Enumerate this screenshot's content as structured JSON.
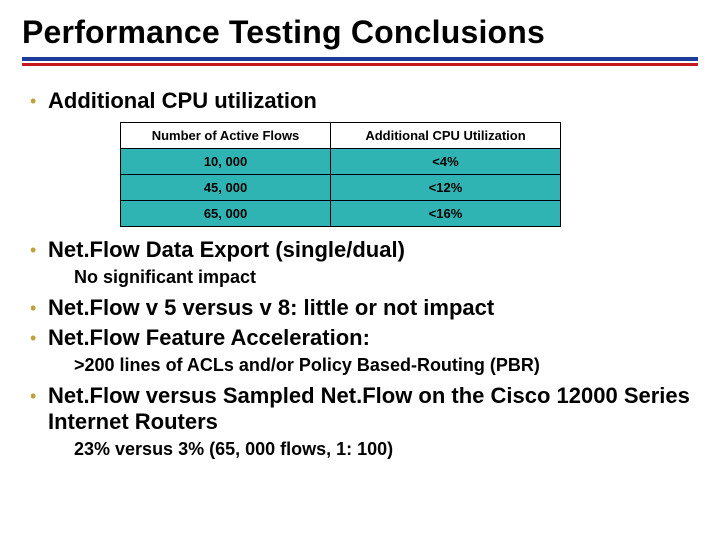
{
  "title": "Performance Testing Conclusions",
  "bullets": {
    "b0": "Additional CPU utilization",
    "b1": "Net.Flow Data Export (single/dual)",
    "b1_sub": "No significant impact",
    "b2": "Net.Flow v 5 versus v 8: little or not impact",
    "b3": "Net.Flow Feature Acceleration:",
    "b3_sub": ">200 lines of ACLs and/or Policy Based-Routing (PBR)",
    "b4": "Net.Flow versus Sampled Net.Flow on the Cisco 12000 Series Internet Routers",
    "b4_sub": "23% versus 3%  (65, 000 flows, 1: 100)"
  },
  "table": {
    "headers": {
      "h0": "Number of Active Flows",
      "h1": "Additional CPU Utilization"
    },
    "rows": [
      {
        "flows": "10, 000",
        "cpu": "<4%"
      },
      {
        "flows": "45, 000",
        "cpu": "<12%"
      },
      {
        "flows": "65, 000",
        "cpu": "<16%"
      }
    ]
  },
  "chart_data": {
    "type": "table",
    "title": "Additional CPU utilization",
    "columns": [
      "Number of Active Flows",
      "Additional CPU Utilization"
    ],
    "rows": [
      [
        "10, 000",
        "<4%"
      ],
      [
        "45, 000",
        "<12%"
      ],
      [
        "65, 000",
        "<16%"
      ]
    ]
  }
}
